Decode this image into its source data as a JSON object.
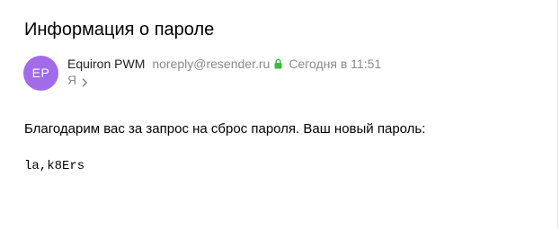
{
  "message": {
    "subject": "Информация о пароле",
    "sender": {
      "initials": "EP",
      "name": "Equiron PWM",
      "email": "noreply@resender.ru",
      "avatar_color": "#a26be9",
      "verified_icon": "lock-icon",
      "verified_color": "#3dbb3d"
    },
    "date": "Сегодня в 11:51",
    "recipient": "Я",
    "recipient_icon": "chevron-right-icon",
    "body": {
      "text": "Благодарим вас за запрос на сброс пароля. Ваш новый пароль:",
      "password": "la,k8Ers"
    }
  }
}
